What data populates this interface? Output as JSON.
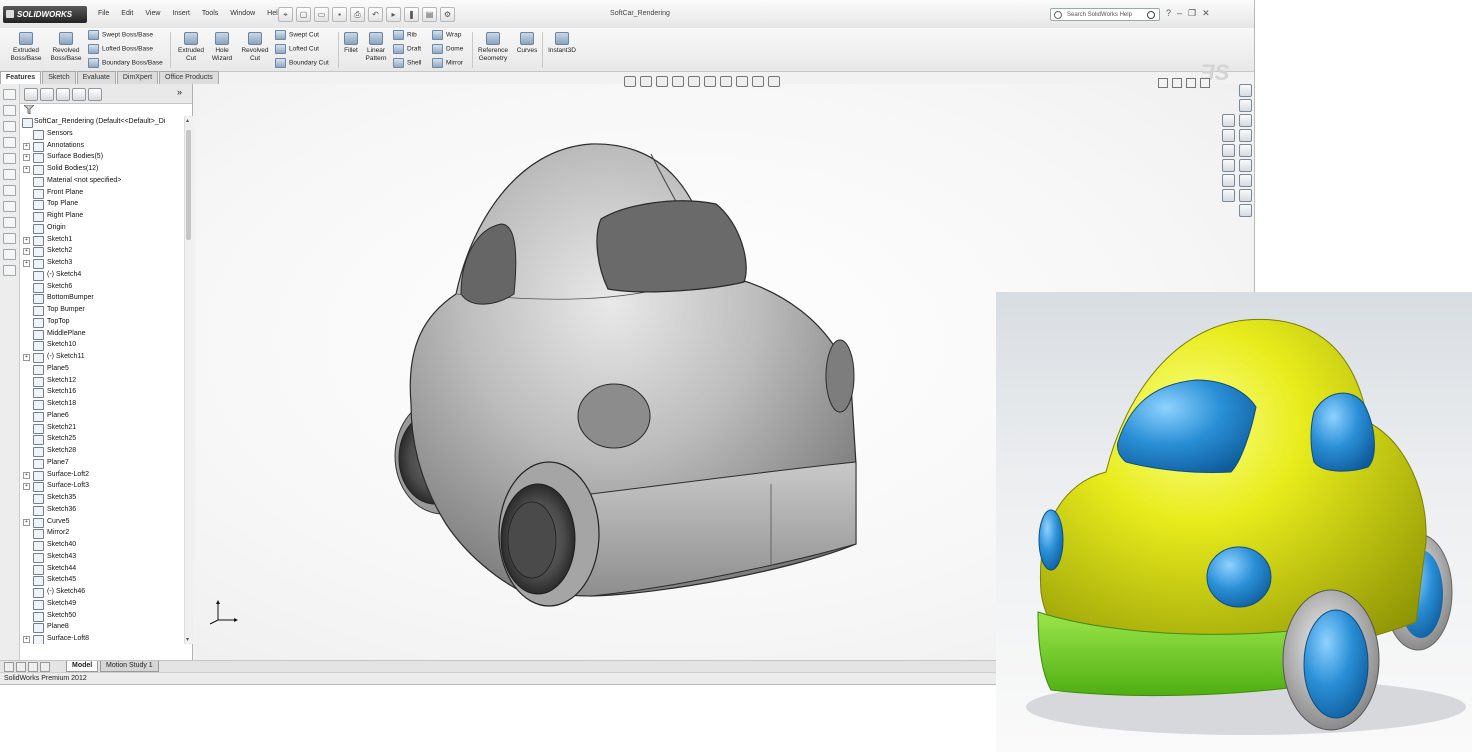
{
  "app": {
    "logo_text": "SOLIDWORKS",
    "window_title": "SoftCar_Rendering",
    "menus": [
      "File",
      "Edit",
      "View",
      "Insert",
      "Tools",
      "Window",
      "Help"
    ],
    "search_placeholder": "Search SolidWorks Help",
    "status_text": "SolidWorks Premium 2012"
  },
  "commands": {
    "extruded_boss": "Extruded Boss/Base",
    "revolved_boss": "Revolved Boss/Base",
    "swept_boss": "Swept Boss/Base",
    "lofted_boss": "Lofted Boss/Base",
    "boundary_boss": "Boundary Boss/Base",
    "extruded_cut": "Extruded Cut",
    "hole_wizard": "Hole Wizard",
    "revolved_cut": "Revolved Cut",
    "swept_cut": "Swept Cut",
    "lofted_cut": "Lofted Cut",
    "boundary_cut": "Boundary Cut",
    "fillet": "Fillet",
    "linear_pattern": "Linear Pattern",
    "rib": "Rib",
    "draft": "Draft",
    "shell": "Shell",
    "wrap": "Wrap",
    "dome": "Dome",
    "mirror": "Mirror",
    "reference_geometry": "Reference Geometry",
    "curves": "Curves",
    "instant3d": "Instant3D"
  },
  "tabs": [
    "Features",
    "Sketch",
    "Evaluate",
    "DimXpert",
    "Office Products"
  ],
  "tree": {
    "root": "SoftCar_Rendering  (Default<<Default>_Di",
    "items": [
      {
        "label": "Sensors",
        "exp": false
      },
      {
        "label": "Annotations",
        "exp": true
      },
      {
        "label": "Surface Bodies(5)",
        "exp": true
      },
      {
        "label": "Solid Bodies(12)",
        "exp": true
      },
      {
        "label": "Material <not specified>",
        "exp": false
      },
      {
        "label": "Front Plane",
        "exp": false
      },
      {
        "label": "Top Plane",
        "exp": false
      },
      {
        "label": "Right Plane",
        "exp": false
      },
      {
        "label": "Origin",
        "exp": false
      },
      {
        "label": "Sketch1",
        "exp": true
      },
      {
        "label": "Sketch2",
        "exp": true
      },
      {
        "label": "Sketch3",
        "exp": true
      },
      {
        "label": "(-) Sketch4",
        "exp": false
      },
      {
        "label": "Sketch6",
        "exp": false
      },
      {
        "label": "BottomBumper",
        "exp": false
      },
      {
        "label": "Top Bumper",
        "exp": false
      },
      {
        "label": "TopTop",
        "exp": false
      },
      {
        "label": "MiddlePlane",
        "exp": false
      },
      {
        "label": "Sketch10",
        "exp": false
      },
      {
        "label": "(-) Sketch11",
        "exp": true
      },
      {
        "label": "Plane5",
        "exp": false
      },
      {
        "label": "Sketch12",
        "exp": false
      },
      {
        "label": "Sketch16",
        "exp": false
      },
      {
        "label": "Sketch18",
        "exp": false
      },
      {
        "label": "Plane6",
        "exp": false
      },
      {
        "label": "Sketch21",
        "exp": false
      },
      {
        "label": "Sketch25",
        "exp": false
      },
      {
        "label": "Sketch28",
        "exp": false
      },
      {
        "label": "Plane7",
        "exp": false
      },
      {
        "label": "Surface-Loft2",
        "exp": true
      },
      {
        "label": "Surface-Loft3",
        "exp": true
      },
      {
        "label": "Sketch35",
        "exp": false
      },
      {
        "label": "Sketch36",
        "exp": false
      },
      {
        "label": "Curve5",
        "exp": true
      },
      {
        "label": "Mirror2",
        "exp": false
      },
      {
        "label": "Sketch40",
        "exp": false
      },
      {
        "label": "Sketch43",
        "exp": false
      },
      {
        "label": "Sketch44",
        "exp": false
      },
      {
        "label": "Sketch45",
        "exp": false
      },
      {
        "label": "(-) Sketch46",
        "exp": false
      },
      {
        "label": "Sketch49",
        "exp": false
      },
      {
        "label": "Sketch50",
        "exp": false
      },
      {
        "label": "Plane8",
        "exp": false
      },
      {
        "label": "Surface-Loft8",
        "exp": true
      }
    ]
  },
  "bottom_tabs": [
    "Model",
    "Motion Study 1"
  ],
  "colors": {
    "car_body_rendered": "#e4e81a",
    "car_bumper_rendered": "#7ed321",
    "car_glass_rendered": "#2a8fd6",
    "car_body_model": "#a9a9a9"
  }
}
